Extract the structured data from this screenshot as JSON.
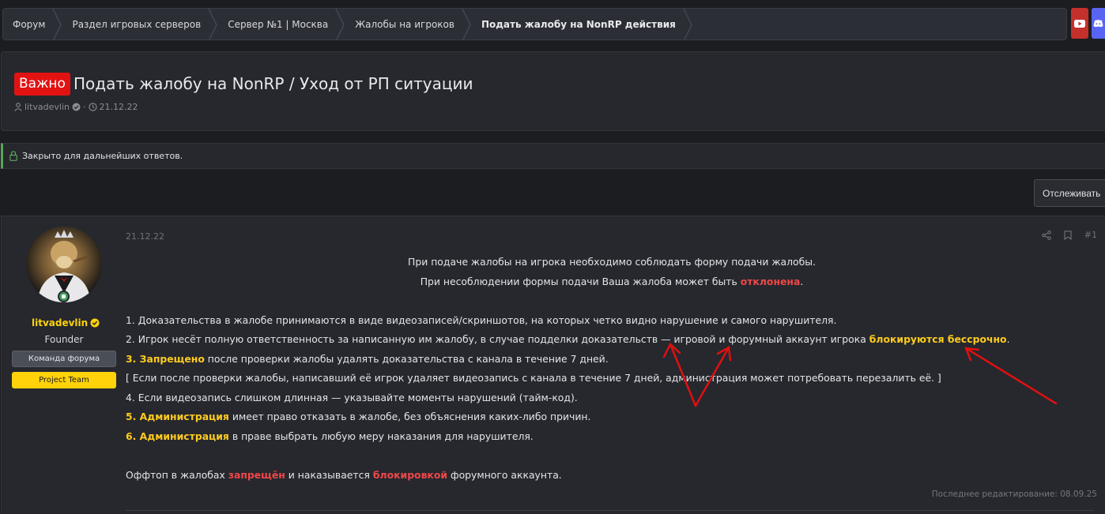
{
  "breadcrumb": [
    "Форум",
    "Раздел игровых серверов",
    "Сервер №1 | Москва",
    "Жалобы на игроков",
    "Подать жалобу на NonRP действия"
  ],
  "thread": {
    "prefix": "Важно",
    "title": "Подать жалобу на NonRP / Уход от РП ситуации",
    "author": "litvadevlin",
    "meta_sep": "·",
    "date": "21.12.22"
  },
  "notice": "Закрыто для дальнейших ответов.",
  "follow_label": "Отслеживать",
  "post": {
    "user": {
      "name": "litvadevlin",
      "title": "Founder",
      "banners": [
        "Команда форума",
        "Project Team"
      ]
    },
    "date": "21.12.22",
    "number": "#1",
    "intro1": "При подаче жалобы на игрока необходимо соблюдать форму подачи жалобы.",
    "intro2a": "При несоблюдении формы подачи Ваша жалоба может быть ",
    "intro2b": "отклонена",
    "intro2c": ".",
    "r1": "1. Доказательства в жалобе принимаются в виде видеозаписей/скриншотов, на которых четко видно нарушение и самого нарушителя.",
    "r2a": "2. Игрок несёт полную ответственность за написанную им жалобу, в случае подделки доказательств — игровой и форумный аккаунт игрока ",
    "r2b": "блокируются бессрочно",
    "r2c": ".",
    "r3num": "3. ",
    "r3a": "Запрещено",
    "r3b": " после проверки жалобы удалять доказательства с канала в течение 7 дней.",
    "r3note": "[ Если после проверки жалобы, написавший её игрок удаляет видеозапись с канала в течение 7 дней, администрация может потребовать перезалить её. ]",
    "r4": "4. Если видеозапись слишком длинная — указывайте моменты нарушений (тайм-код).",
    "r5num": "5. ",
    "r5a": "Администрация",
    "r5b": " имеет право отказать в жалобе, без объяснения каких-либо причин.",
    "r6num": "6. ",
    "r6a": "Администрация",
    "r6b": " в праве выбрать любую меру наказания для нарушителя.",
    "off_a": "Оффтоп в жалобах ",
    "off_b": "запрещён",
    "off_c": " и наказывается ",
    "off_d": "блокировкой",
    "off_e": " форумного аккаунта.",
    "edited": "Последнее редактирование: 08.09.25"
  },
  "colors": {
    "important": "#e31212",
    "username": "#ffd20a",
    "highlight_red": "#f04747",
    "highlight_yellow": "#ffcb1f",
    "annotation_arrow": "#e01010"
  },
  "icons": [
    "youtube-icon",
    "discord-icon",
    "user-icon",
    "verified-icon",
    "clock-icon",
    "lock-icon",
    "share-icon",
    "bookmark-icon"
  ]
}
